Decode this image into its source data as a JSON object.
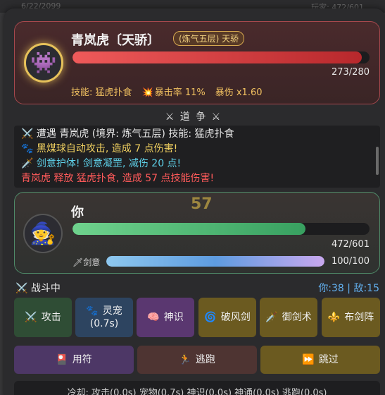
{
  "bg_header": {
    "left": "6/22/2099",
    "right": "玩家: 472/601"
  },
  "enemy": {
    "name": "青岚虎〔天骄〕",
    "realm": "(炼气五层) 天骄",
    "hp_text": "273/280",
    "hp_fraction": 0.975,
    "avatar_icon": "alien-monster-icon",
    "skill": "技能: 猛虎扑食",
    "crit": "暴击率 11%",
    "crit_dmg": "暴伤 x1.60"
  },
  "divider": "⚔ 道 争 ⚔",
  "log": [
    {
      "text": "⚔️ 遭遇 青岚虎 (境界: 炼气五层) 技能: 猛虎扑食",
      "color": "#e8e8e8"
    },
    {
      "text": "🐾 黑煤球自动攻击, 造成 7 点伤害!",
      "color": "#f0d060"
    },
    {
      "text": "🗡️ 剑意护体! 剑意凝罡, 减伤 20 点!",
      "color": "#5ed0e8"
    },
    {
      "text": "青岚虎 释放 猛虎扑食, 造成 57 点技能伤害!",
      "color": "#ff5a5a"
    }
  ],
  "player": {
    "name": "你",
    "damage_float": "57",
    "hp_text": "472/601",
    "hp_fraction": 0.785,
    "sword_label": "🗡剑意",
    "sword_text": "100/100",
    "sword_fraction": 1.0
  },
  "status": "⚔️ 战斗中",
  "hp_summary": "你:38 | 敌:15",
  "skills": [
    {
      "label": "攻击",
      "icon": "⚔️",
      "sub": ""
    },
    {
      "label": "灵宠",
      "icon": "🐾",
      "sub": "(0.7s)"
    },
    {
      "label": "神识",
      "icon": "🧠",
      "sub": ""
    },
    {
      "label": "破风剑",
      "icon": "🌀",
      "sub": ""
    },
    {
      "label": "御剑术",
      "icon": "🗡️",
      "sub": ""
    },
    {
      "label": "布剑阵",
      "icon": "⚜️",
      "sub": ""
    }
  ],
  "actions": [
    {
      "label": "用符",
      "icon": "🎴"
    },
    {
      "label": "逃跑",
      "icon": "🏃"
    },
    {
      "label": "跳过",
      "icon": "⏩"
    }
  ],
  "cooldown": "冷却: 攻击(0.0s) 宠物(0.7s) 神识(0.0s) 神通(0.0s) 逃跑(0.0s)"
}
